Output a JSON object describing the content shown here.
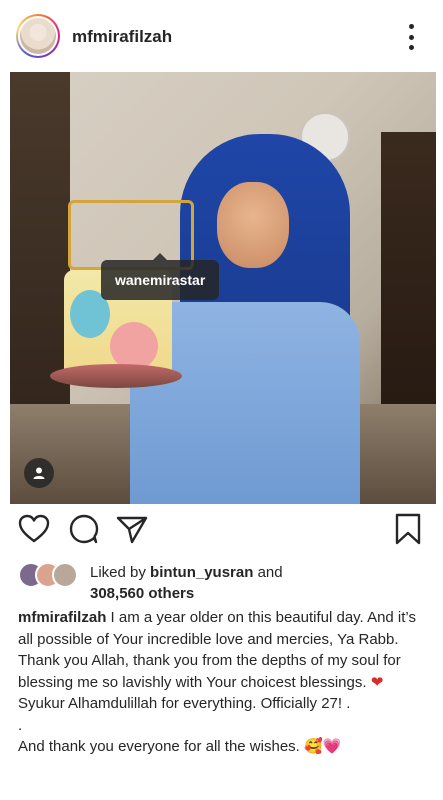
{
  "post": {
    "username": "mfmirafilzah",
    "tagged_user": "wanemirastar"
  },
  "likes": {
    "prefix": "Liked by",
    "user": "bintun_yusran",
    "conjunction": "and",
    "count": "308,560 others"
  },
  "caption": {
    "username": "mfmirafilzah",
    "text": "I am a year older on this beautiful day. And it’s all possible of Your incredible love and mercies, Ya Rabb. Thank you Allah, thank you from the depths of my soul for blessing me so lavishly with Your choicest blessings.",
    "heart_emoji": "❤",
    "text2": "Syukur Alhamdulillah for everything. Officially 27! .",
    "dot_line": ".",
    "text3": "And thank you everyone for all the wishes.",
    "emoji_face": "🥰",
    "emoji_heart": "💗"
  },
  "icons": {
    "more": "more-options-icon",
    "like": "heart-icon",
    "comment": "comment-icon",
    "share": "share-icon",
    "save": "bookmark-icon",
    "tagged": "user-icon"
  },
  "colors": {
    "text": "#262626",
    "heart_emoji": "#d92b2b",
    "tag_background": "#262626"
  }
}
